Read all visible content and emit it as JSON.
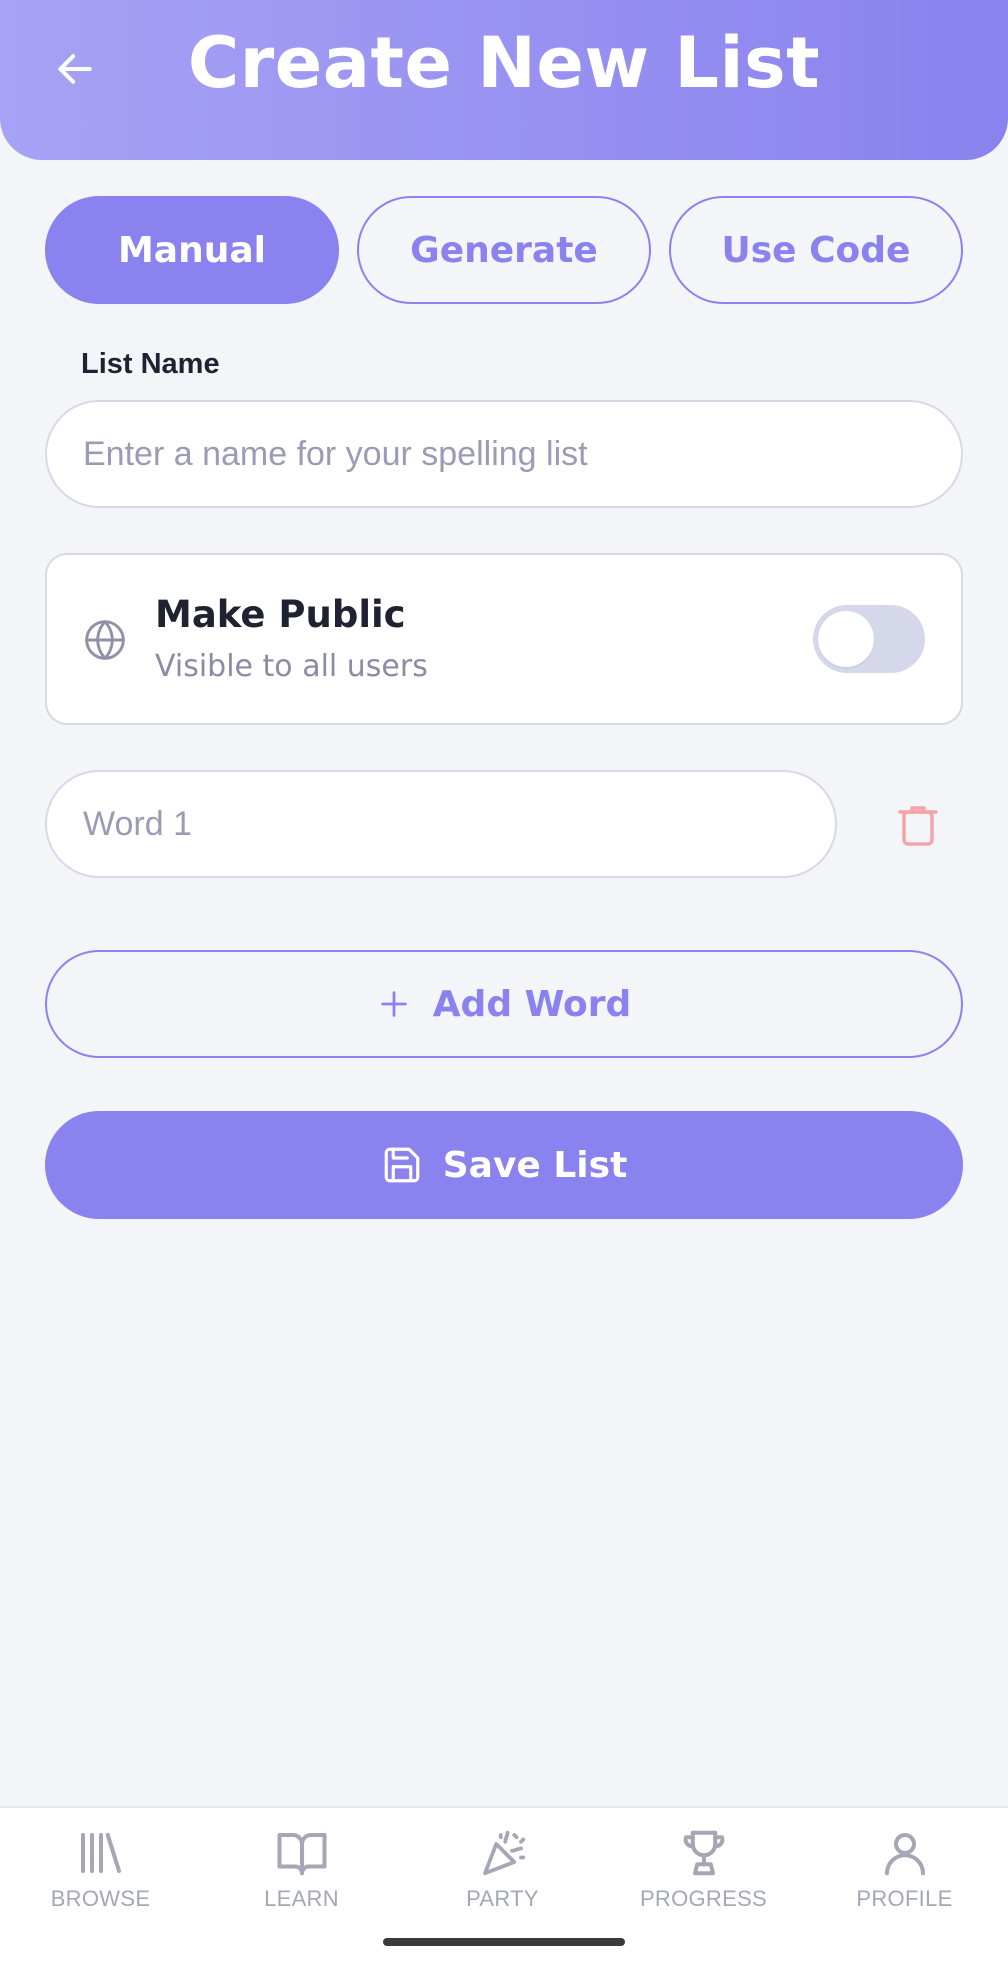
{
  "header": {
    "title": "Create New List",
    "back_icon": "arrow-left-icon"
  },
  "mode_tabs": [
    {
      "label": "Manual",
      "active": true
    },
    {
      "label": "Generate",
      "active": false
    },
    {
      "label": "Use Code",
      "active": false
    }
  ],
  "list_name": {
    "label": "List Name",
    "value": "",
    "placeholder": "Enter a name for your spelling list"
  },
  "make_public": {
    "icon": "globe-icon",
    "title": "Make Public",
    "subtitle": "Visible to all users",
    "enabled": false
  },
  "words": [
    {
      "value": "",
      "placeholder": "Word 1",
      "delete_icon": "trash-icon"
    }
  ],
  "actions": {
    "add_word_label": "Add Word",
    "save_label": "Save List"
  },
  "bottom_nav": [
    {
      "label": "BROWSE",
      "icon": "library-icon"
    },
    {
      "label": "LEARN",
      "icon": "book-open-icon"
    },
    {
      "label": "PARTY",
      "icon": "party-popper-icon"
    },
    {
      "label": "PROGRESS",
      "icon": "trophy-icon"
    },
    {
      "label": "PROFILE",
      "icon": "user-icon"
    }
  ],
  "colors": {
    "accent": "#8a82ee",
    "header_gradient_start": "#a7a2f5",
    "background": "#f4f5f9",
    "danger": "#f4a3a8",
    "nav_inactive": "#a5a7b6"
  }
}
